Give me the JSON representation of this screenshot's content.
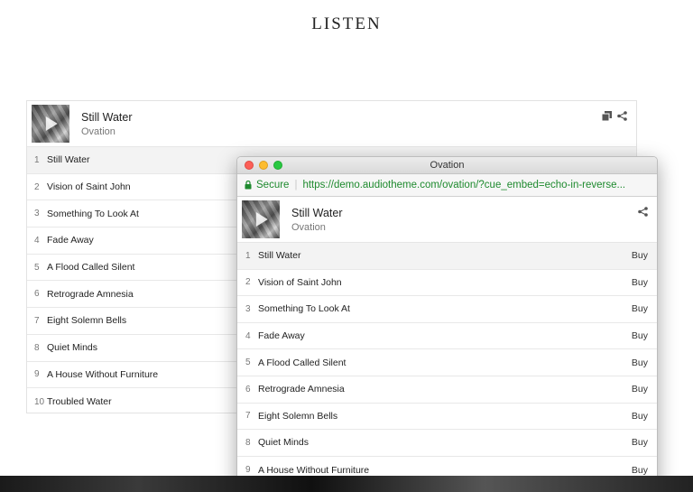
{
  "page": {
    "heading": "LISTEN"
  },
  "background_player": {
    "now_playing": {
      "title": "Still Water",
      "artist": "Ovation"
    },
    "icons": [
      "playlist-icon",
      "share-icon"
    ],
    "tracks": [
      {
        "num": "1",
        "name": "Still Water"
      },
      {
        "num": "2",
        "name": "Vision of Saint John"
      },
      {
        "num": "3",
        "name": "Something To Look At"
      },
      {
        "num": "4",
        "name": "Fade Away"
      },
      {
        "num": "5",
        "name": "A Flood Called Silent"
      },
      {
        "num": "6",
        "name": "Retrograde Amnesia"
      },
      {
        "num": "7",
        "name": "Eight Solemn Bells"
      },
      {
        "num": "8",
        "name": "Quiet Minds"
      },
      {
        "num": "9",
        "name": "A House Without Furniture"
      },
      {
        "num": "10",
        "name": "Troubled Water"
      }
    ]
  },
  "browser": {
    "window_title": "Ovation",
    "address": {
      "secure_label": "Secure",
      "url": "https://demo.audiotheme.com/ovation/?cue_embed=echo-in-reverse..."
    },
    "now_playing": {
      "title": "Still Water",
      "artist": "Ovation"
    },
    "buy_label": "Buy",
    "tracks": [
      {
        "num": "1",
        "name": "Still Water"
      },
      {
        "num": "2",
        "name": "Vision of Saint John"
      },
      {
        "num": "3",
        "name": "Something To Look At"
      },
      {
        "num": "4",
        "name": "Fade Away"
      },
      {
        "num": "5",
        "name": "A Flood Called Silent"
      },
      {
        "num": "6",
        "name": "Retrograde Amnesia"
      },
      {
        "num": "7",
        "name": "Eight Solemn Bells"
      },
      {
        "num": "8",
        "name": "Quiet Minds"
      },
      {
        "num": "9",
        "name": "A House Without Furniture"
      }
    ]
  },
  "colors": {
    "secure_green": "#1e8a2e",
    "active_row": "#f3f3f3"
  }
}
